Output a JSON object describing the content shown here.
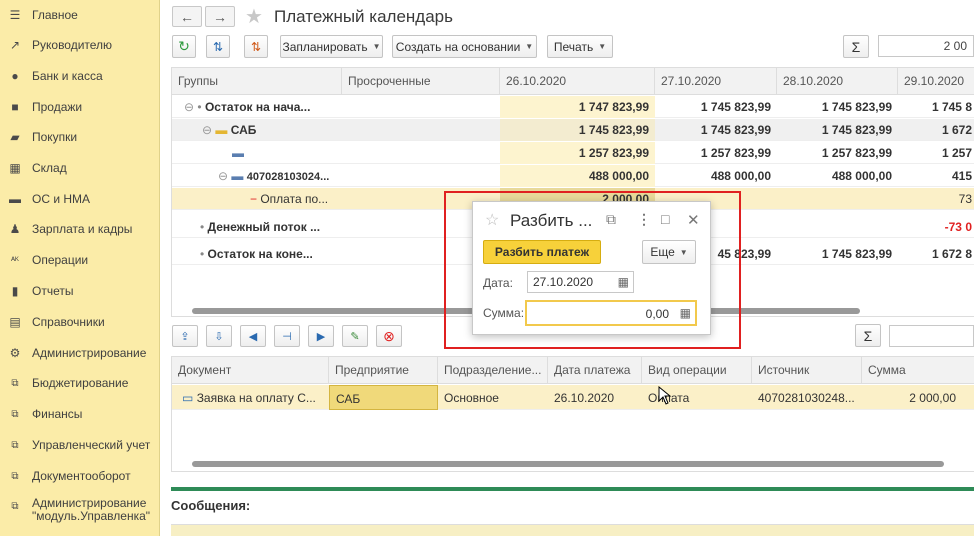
{
  "sidebar": {
    "items": [
      {
        "label": "Главное",
        "icon": "menu-icon"
      },
      {
        "label": "Руководителю",
        "icon": "trend-icon"
      },
      {
        "label": "Банк и касса",
        "icon": "coin-icon"
      },
      {
        "label": "Продажи",
        "icon": "bag-icon"
      },
      {
        "label": "Покупки",
        "icon": "cart-icon"
      },
      {
        "label": "Склад",
        "icon": "warehouse-icon"
      },
      {
        "label": "ОС и НМА",
        "icon": "truck-icon"
      },
      {
        "label": "Зарплата и кадры",
        "icon": "person-icon"
      },
      {
        "label": "Операции",
        "icon": "operations-icon"
      },
      {
        "label": "Отчеты",
        "icon": "bar-chart-icon"
      },
      {
        "label": "Справочники",
        "icon": "books-icon"
      },
      {
        "label": "Администрирование",
        "icon": "gear-icon"
      },
      {
        "label": "Бюджетирование",
        "icon": "link-icon"
      },
      {
        "label": "Финансы",
        "icon": "link-icon"
      },
      {
        "label": "Управленческий учет",
        "icon": "link-icon"
      },
      {
        "label": "Документооборот",
        "icon": "link-icon"
      },
      {
        "label": "Администрирование \"модуль.Управленка\"",
        "icon": "link-icon"
      }
    ]
  },
  "header": {
    "back": "←",
    "forward": "→",
    "title": "Платежный календарь"
  },
  "toolbar": {
    "plan": "Запланировать",
    "create_based": "Создать на основании",
    "print": "Печать",
    "sum_symbol": "Σ",
    "total_value": "2 00"
  },
  "grid1": {
    "headers": [
      "Группы",
      "Просроченные",
      "26.10.2020",
      "27.10.2020",
      "28.10.2020",
      "29.10.2020"
    ],
    "rows": [
      {
        "label": "Остаток на нача...",
        "values": [
          "1 747 823,99",
          "1 745 823,99",
          "1 745 823,99",
          "1 745 8"
        ]
      },
      {
        "label": "САБ",
        "values": [
          "1 745 823,99",
          "1 745 823,99",
          "1 745 823,99",
          "1 672"
        ]
      },
      {
        "label": "",
        "values": [
          "1 257 823,99",
          "1 257 823,99",
          "1 257 823,99",
          "1 257"
        ]
      },
      {
        "label": "407028103024...",
        "values": [
          "488 000,00",
          "488 000,00",
          "488 000,00",
          "415"
        ]
      },
      {
        "label": "Оплата по...",
        "values": [
          "2 000,00",
          "",
          "",
          "73"
        ]
      },
      {
        "label": "Денежный поток ...",
        "values": [
          "",
          "",
          "",
          "-73 0"
        ]
      },
      {
        "label": "Остаток на коне...",
        "values": [
          "",
          "45 823,99",
          "1 745 823,99",
          "1 672 8"
        ]
      }
    ]
  },
  "grid2": {
    "headers": [
      "Документ",
      "Предприятие",
      "Подразделение...",
      "Дата платежа",
      "Вид операции",
      "Источник",
      "Сумма"
    ],
    "row": [
      "Заявка на оплату С...",
      "САБ",
      "Основное",
      "26.10.2020",
      "Оплата",
      "4070281030248...",
      "2 000,00"
    ]
  },
  "messages": {
    "label": "Сообщения:"
  },
  "dialog": {
    "title": "Разбить ...",
    "split_btn": "Разбить платеж",
    "more_btn": "Еще",
    "date_label": "Дата:",
    "date_value": "27.10.2020",
    "sum_label": "Сумма:",
    "sum_value": "0,00"
  },
  "colors": {
    "sidebar": "#fbeca8",
    "accent": "#f7d13a",
    "highlight": "#e02020"
  }
}
